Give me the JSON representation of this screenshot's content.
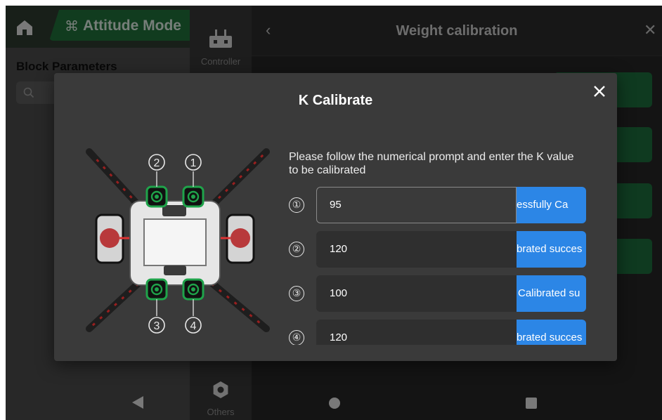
{
  "topbar": {
    "mode_icon": "drone-icon",
    "mode_label": "Attitude Mode"
  },
  "left_panel": {
    "title": "Block Parameters",
    "search_placeholder": ""
  },
  "mid_nav": {
    "controller_label": "Controller",
    "others_label": "Others"
  },
  "weight_panel": {
    "title": "Weight calibration",
    "back_icon": "chevron-left-icon",
    "close_icon": "close-icon"
  },
  "modal": {
    "title": "K Calibrate",
    "prompt": "Please follow the numerical prompt and enter the K value to be calibrated",
    "diagram_labels": [
      "②",
      "①",
      "③",
      "④"
    ],
    "rows": [
      {
        "num": "①",
        "value": "95",
        "button_text": "essfully    Ca"
      },
      {
        "num": "②",
        "value": "120",
        "button_text": "brated succes"
      },
      {
        "num": "③",
        "value": "100",
        "button_text": "Calibrated su"
      },
      {
        "num": "④",
        "value": "120",
        "button_text": "brated succes"
      }
    ]
  },
  "colors": {
    "accent_blue": "#2c86e6",
    "mode_green": "#1f6d3a",
    "modal_bg": "#3a3a3a",
    "motor_green": "#1fa34a"
  }
}
